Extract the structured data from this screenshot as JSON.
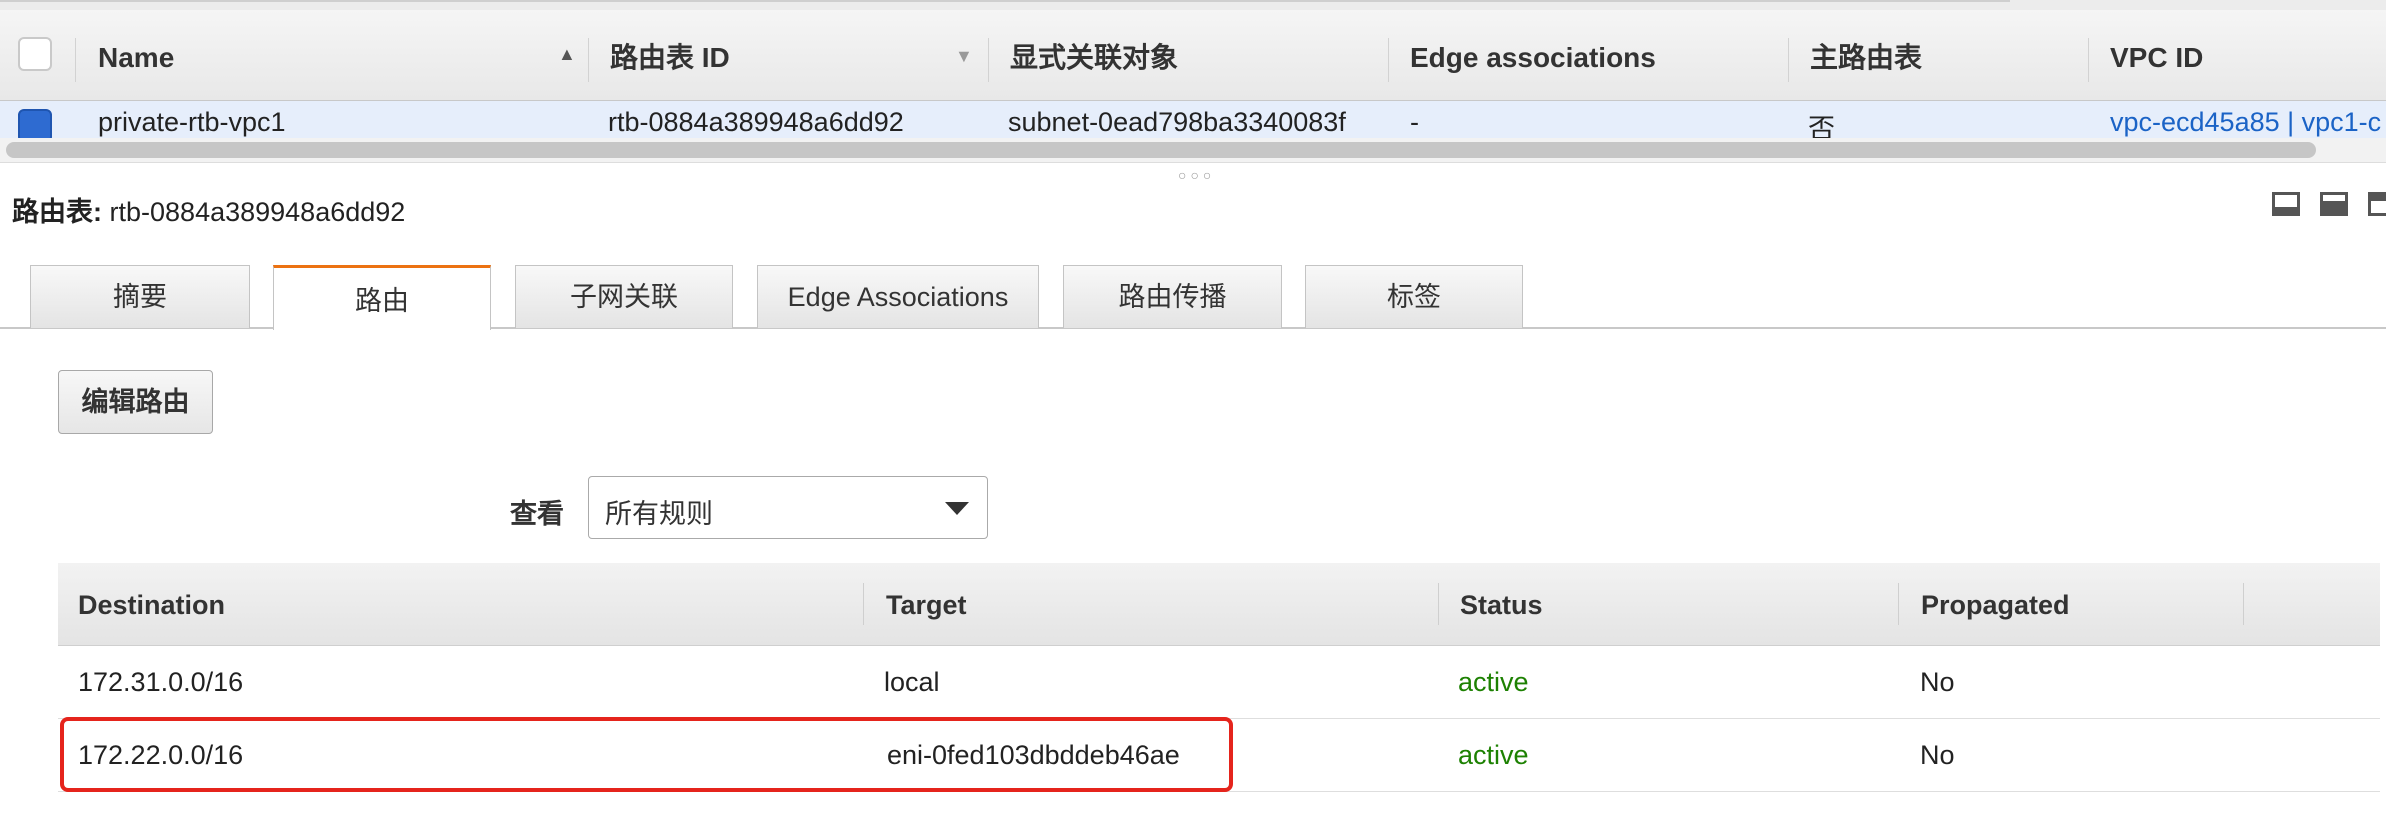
{
  "top_table": {
    "headers": {
      "name": "Name",
      "route_table_id": "路由表 ID",
      "explicit_assoc": "显式关联对象",
      "edge_assoc": "Edge associations",
      "main": "主路由表",
      "vpc_id": "VPC ID"
    },
    "row": {
      "name": "private-rtb-vpc1",
      "route_table_id": "rtb-0884a389948a6dd92",
      "explicit_assoc": "subnet-0ead798ba3340083f",
      "edge_assoc": "-",
      "main": "否",
      "vpc_id": "vpc-ecd45a85 | vpc1-c"
    }
  },
  "panel": {
    "title_label": "路由表:",
    "title_value": "rtb-0884a389948a6dd92"
  },
  "tabs": [
    {
      "label": "摘要"
    },
    {
      "label": "路由"
    },
    {
      "label": "子网关联"
    },
    {
      "label": "Edge Associations"
    },
    {
      "label": "路由传播"
    },
    {
      "label": "标签"
    }
  ],
  "active_tab": "路由",
  "edit_routes_label": "编辑路由",
  "view": {
    "label": "查看",
    "selected": "所有规则"
  },
  "routes_table": {
    "headers": {
      "destination": "Destination",
      "target": "Target",
      "status": "Status",
      "propagated": "Propagated"
    },
    "rows": [
      {
        "destination": "172.31.0.0/16",
        "target": "local",
        "status": "active",
        "propagated": "No"
      },
      {
        "destination": "172.22.0.0/16",
        "target": "eni-0fed103dbddeb46ae",
        "status": "active",
        "propagated": "No"
      }
    ]
  },
  "colors": {
    "link": "#1b63c6",
    "status_active": "#1d8102",
    "tab_active_accent": "#ec7211",
    "highlight_box": "#e5241c",
    "selected_row": "#e6eefb"
  }
}
